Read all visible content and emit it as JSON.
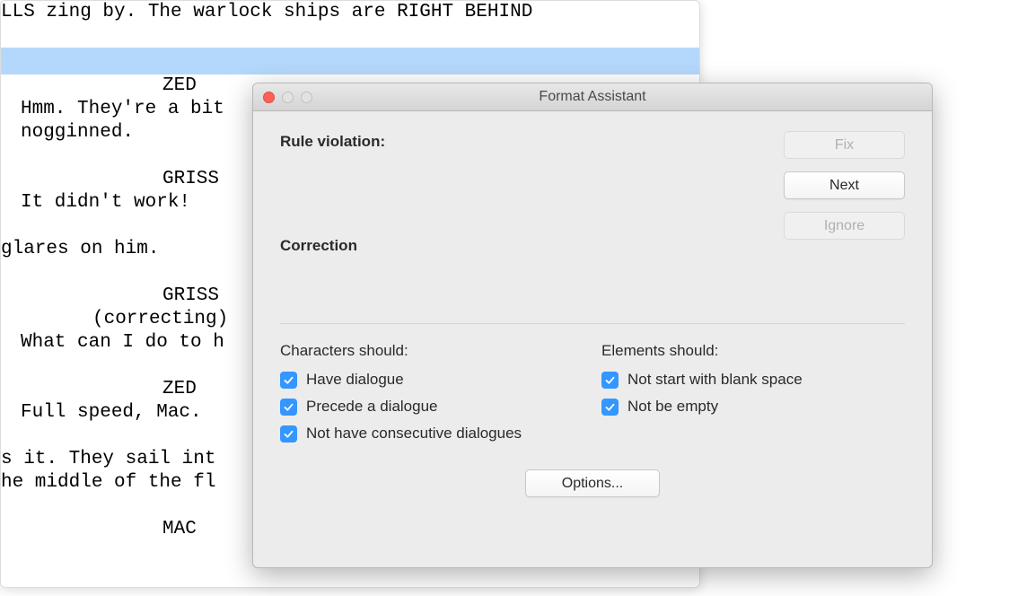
{
  "screenplay": {
    "lines": [
      {
        "cls": "action-o",
        "text": "LLS zing by. The warlock ships are RIGHT BEHIND"
      },
      {
        "cls": "blank",
        "text": ""
      },
      {
        "cls": "highlight",
        "text": ""
      },
      {
        "cls": "character",
        "text": "ZED"
      },
      {
        "cls": "",
        "text": "Hmm. They're a bit"
      },
      {
        "cls": "",
        "text": "nogginned."
      },
      {
        "cls": "blank",
        "text": ""
      },
      {
        "cls": "character",
        "text": "GRISS"
      },
      {
        "cls": "",
        "text": "It didn't work!"
      },
      {
        "cls": "blank",
        "text": ""
      },
      {
        "cls": "action-o",
        "text": "glares on him."
      },
      {
        "cls": "blank",
        "text": ""
      },
      {
        "cls": "character",
        "text": "GRISS"
      },
      {
        "cls": "parenthetical",
        "text": "(correcting)"
      },
      {
        "cls": "",
        "text": "What can I do to h"
      },
      {
        "cls": "blank",
        "text": ""
      },
      {
        "cls": "character",
        "text": "ZED"
      },
      {
        "cls": "",
        "text": "Full speed, Mac."
      },
      {
        "cls": "blank",
        "text": ""
      },
      {
        "cls": "action-o",
        "text": "s it. They sail int"
      },
      {
        "cls": "action-o",
        "text": "he middle of the fl"
      },
      {
        "cls": "blank",
        "text": ""
      },
      {
        "cls": "character",
        "text": "MAC"
      }
    ]
  },
  "dialog": {
    "title": "Format Assistant",
    "rule_violation_label": "Rule violation:",
    "correction_label": "Correction",
    "buttons": {
      "fix": "Fix",
      "next": "Next",
      "ignore": "Ignore"
    },
    "characters_header": "Characters should:",
    "elements_header": "Elements should:",
    "char_checks": [
      "Have dialogue",
      "Precede a dialogue",
      "Not have consecutive dialogues"
    ],
    "elem_checks": [
      "Not start with blank space",
      "Not be empty"
    ],
    "options_button": "Options..."
  }
}
